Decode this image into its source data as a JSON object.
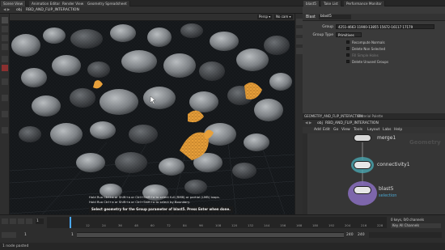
{
  "tabs": [
    "Scene View",
    "Animation Editor",
    "Render View",
    "Geometry Spreadsheet"
  ],
  "right_tabs": [
    "blast5",
    "Take List",
    "Performance Monitor"
  ],
  "path_left": {
    "obj": "obj",
    "geo": "RBD_AND_FLIP_INTERACTION"
  },
  "path_right": {
    "obj": "obj",
    "geo": "RBD_AND_FLIP_INTERACTION"
  },
  "viewport": {
    "cam_menu": "Persp ▾",
    "view_menu": "No cam ▾",
    "hint_line1": "Hold Ruo Ctrl+a or Shift+a or Ctrl+Shift+a to select full (RMB) or partial (LMB) loops.",
    "hint_line2": "Hold Ruo Ctrl+a or Shift+a or Ctrl+Shift+a to select by Boundary.",
    "prompt": "Select geometry for the Group parameter of blast5. Press Enter when done."
  },
  "params": {
    "node_type": "Blast",
    "node_name": "blast5",
    "group_label": "Group",
    "group_value": "4251-4663 11900-13855 15672-16117 17179",
    "group_type_label": "Group Type",
    "group_type_value": "Primitives",
    "checkboxes": [
      "Recompute Normals",
      "Delete Non Selected",
      "Fill Simple Holes",
      "Delete Unused Groups"
    ]
  },
  "network": {
    "path": "GEOMETRY_AND_FLIP_INTERACTION",
    "palette_tab": "Material Palette",
    "menus": [
      "Add",
      "Edit",
      "Go",
      "View",
      "Tools",
      "Layout",
      "Labs",
      "Help"
    ],
    "context_label": "Geometry",
    "nodes": [
      {
        "name": "merge1",
        "sublabel": ""
      },
      {
        "name": "connectivity1",
        "sublabel": ""
      },
      {
        "name": "blast5",
        "sublabel": "selection"
      }
    ]
  },
  "timeline": {
    "frame": "1",
    "start": "1",
    "end": "1",
    "range_end": "240",
    "range_end2": "240",
    "ticks": [
      "12",
      "24",
      "36",
      "48",
      "60",
      "72",
      "84",
      "96",
      "108",
      "120",
      "132",
      "144",
      "156",
      "168",
      "180",
      "192",
      "204",
      "216",
      "228"
    ],
    "keys_info": "0 keys, 0/0 channels",
    "channels_btn": "Key All Channels",
    "status": "1 node pasted"
  },
  "colors": {
    "accent_orange": "#e8a03a",
    "node_teal": "#4aa6b0",
    "node_purple": "#8a6fc0"
  }
}
